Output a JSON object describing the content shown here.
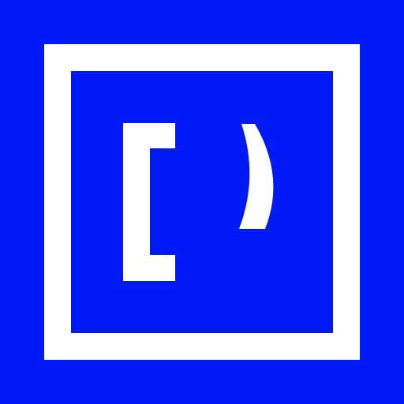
{
  "app_icon": {
    "icon_name": "bracket-logo-icon",
    "colors": {
      "background": "#0019f5",
      "foreground": "#ffffff"
    }
  }
}
